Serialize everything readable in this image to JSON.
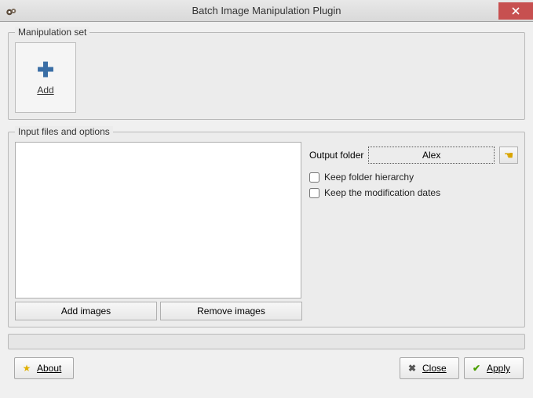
{
  "window": {
    "title": "Batch Image Manipulation Plugin"
  },
  "manipulation": {
    "legend": "Manipulation set",
    "add_label": "Add"
  },
  "input": {
    "legend": "Input files and options",
    "output_label": "Output folder",
    "output_value": "Alex",
    "keep_hierarchy": "Keep folder hierarchy",
    "keep_dates": "Keep the modification dates",
    "add_images": "Add images",
    "remove_images": "Remove images"
  },
  "footer": {
    "about": "About",
    "close": "Close",
    "apply": "Apply"
  }
}
